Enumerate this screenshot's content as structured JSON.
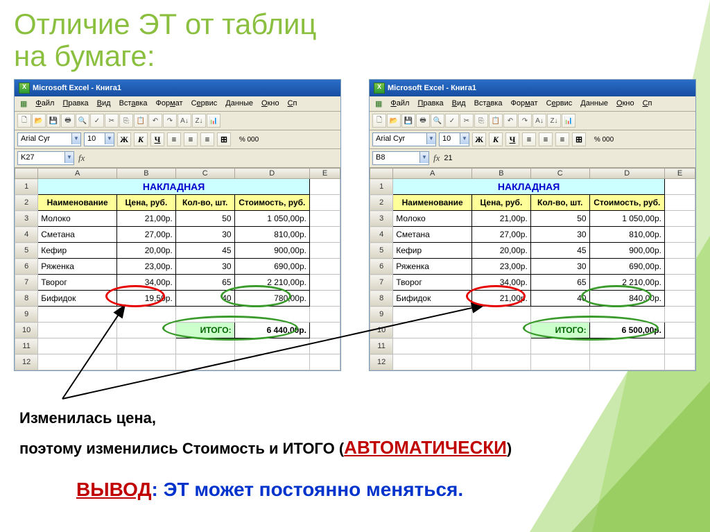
{
  "slide_title_line1": "Отличие ЭТ от таблиц",
  "slide_title_line2": "на бумаге:",
  "excel_title": "Microsoft Excel - Книга1",
  "menus": [
    "Файл",
    "Правка",
    "Вид",
    "Вставка",
    "Формат",
    "Сервис",
    "Данные",
    "Окно",
    "Сп"
  ],
  "font_name": "Arial Cyr",
  "font_size": "10",
  "fmt_bold": "Ж",
  "fmt_italic": "К",
  "fmt_underline": "Ч",
  "fmt_percent": "% 000",
  "left": {
    "cell_ref": "K27",
    "formula_value": "",
    "title": "НАКЛАДНАЯ",
    "headers": [
      "Наименование",
      "Цена, руб.",
      "Кол-во, шт.",
      "Стоимость, руб."
    ],
    "rows": [
      [
        "Молоко",
        "21,00р.",
        "50",
        "1 050,00р."
      ],
      [
        "Сметана",
        "27,00р.",
        "30",
        "810,00р."
      ],
      [
        "Кефир",
        "20,00р.",
        "45",
        "900,00р."
      ],
      [
        "Ряженка",
        "23,00р.",
        "30",
        "690,00р."
      ],
      [
        "Творог",
        "34,00р.",
        "65",
        "2 210,00р."
      ],
      [
        "Бифидок",
        "19,50р.",
        "40",
        "780,00р."
      ]
    ],
    "total_label": "ИТОГО:",
    "total_value": "6 440,00р."
  },
  "right": {
    "cell_ref": "B8",
    "formula_value": "21",
    "title": "НАКЛАДНАЯ",
    "headers": [
      "Наименование",
      "Цена, руб.",
      "Кол-во, шт.",
      "Стоимость, руб."
    ],
    "rows": [
      [
        "Молоко",
        "21,00р.",
        "50",
        "1 050,00р."
      ],
      [
        "Сметана",
        "27,00р.",
        "30",
        "810,00р."
      ],
      [
        "Кефир",
        "20,00р.",
        "45",
        "900,00р."
      ],
      [
        "Ряженка",
        "23,00р.",
        "30",
        "690,00р."
      ],
      [
        "Творог",
        "34,00р.",
        "65",
        "2 210,00р."
      ],
      [
        "Бифидок",
        "21,00р.",
        "40",
        "840,00р."
      ]
    ],
    "total_label": "ИТОГО:",
    "total_value": "6 500,00р."
  },
  "caption_line1": "Изменилась цена,",
  "caption_line2_a": "поэтому изменились Стоимость и ИТОГО (",
  "caption_line2_b": "АВТОМАТИЧЕСКИ",
  "caption_line2_c": ")",
  "conclusion_label": "ВЫВОД",
  "conclusion_colon": ":  ",
  "conclusion_text": "ЭТ может постоянно меняться."
}
